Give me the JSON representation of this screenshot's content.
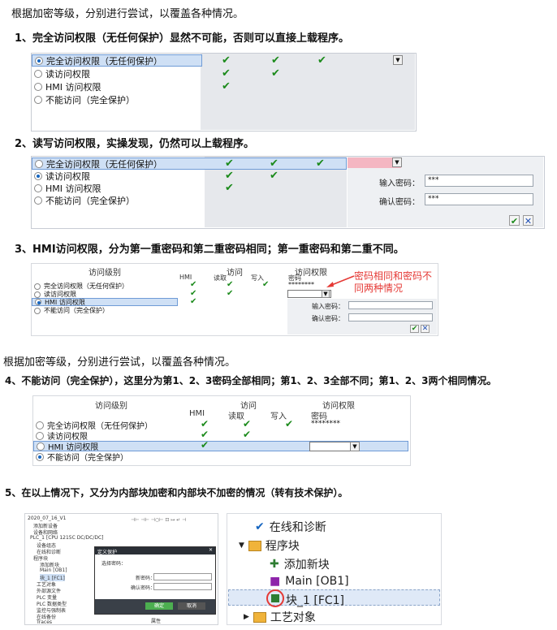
{
  "intro": "根据加密等级，分别进行尝试，以覆盖各种情况。",
  "s1": "1、完全访问权限（无任何保护）显然不可能，否则可以直接上载程序。",
  "s2": "2、读写访问权限，实操发现，仍然可以上载程序。",
  "s3": "3、HMI访问权限，分为第一重密码和第二重密码相同；第一重密码和第二重不同。",
  "intro2": "根据加密等级，分别进行尝试，以覆盖各种情况。",
  "s4": "4、不能访问（完全保护），这里分为第1、2、3密码全部相同；第1、2、3全部不同；第1、2、3两个相同情况。",
  "s5": "5、在以上情况下，又分为内部块加密和内部块不加密的情况（转有技术保护）。",
  "levels": [
    "完全访问权限（无任何保护）",
    "读访问权限",
    "HMI 访问权限",
    "不能访问（完全保护）"
  ],
  "headers": {
    "level": "访问级别",
    "access": "访问",
    "hmi": "HMI",
    "read": "读取",
    "write": "写入",
    "perm": "访问权限",
    "password": "密码"
  },
  "check": "✔",
  "pwd_stars": "********",
  "input_pwd": "输入密码：",
  "confirm_pwd": "确认密码：",
  "stars3": "***",
  "ok": "✔",
  "cancel": "✕",
  "annotation": "密码相同和密码不同两种情况",
  "annotation_l1": "密码相同和密码不",
  "annotation_l2": "同两种情况",
  "tree": {
    "project": "2020_07_16_V1",
    "items": [
      "添加新设备",
      "设备和网络",
      "PLC_1 [CPU 1215C DC/DC/DC]",
      "设备组态",
      "在线和诊断",
      "程序块",
      "添加新块",
      "Main [OB1]",
      "块_1 [FC1]",
      "工艺对象",
      "外部源文件",
      "PLC 变量",
      "PLC 数据类型",
      "监控与强制表",
      "在线备份",
      "Traces"
    ],
    "dialog_title": "定义保护",
    "dialog_pwd": "选择密码：",
    "dialog_new": "新密码：",
    "dialog_confirm": "确认密码：",
    "dialog_ok": "确定",
    "dialog_cancel": "取消",
    "props": "属性"
  },
  "zoom": {
    "online": "在线和诊断",
    "program_blocks": "程序块",
    "add_block": "添加新块",
    "main": "Main [OB1]",
    "fc1": "块_1 [FC1]",
    "tech": "工艺对象"
  },
  "colors": {
    "check": "#1b8a1b",
    "select": "#cfe0f5",
    "pink": "#f4b6c2",
    "annotation": "#e53935"
  }
}
